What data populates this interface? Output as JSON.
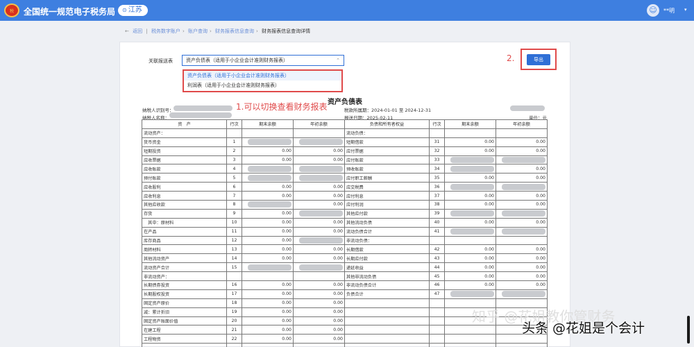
{
  "header": {
    "logo_text": "税",
    "title": "全国统一规范电子税务局",
    "region": "江苏",
    "user_name": "**明",
    "accent_color": "#3e7fe0"
  },
  "breadcrumb": {
    "back": "返回",
    "items": [
      "税务数字账户",
      "账户查询",
      "财务报表信息查询",
      "财务报表信息查询详情"
    ]
  },
  "form": {
    "label": "关联报送表",
    "selected": "资产负债表（适用于小企业会计准则财务报表）",
    "options": [
      "资产负债表（适用于小企业会计准则财务报表）",
      "利润表（适用于小企业会计准则财务报表）"
    ],
    "export_button": "导出"
  },
  "annotations": {
    "switch_note": "1.可以切换查看财务报表",
    "export_note": "2."
  },
  "report": {
    "title": "资产负债表",
    "taxpayer_id_label": "纳税人识别号：",
    "taxpayer_name_label": "纳税人名称：",
    "period": "税款所属期：2024-01-01 至 2024-12-31",
    "filed": "报送日期：2025-02-11",
    "unit": "单位：元",
    "headers": [
      "资　产",
      "行次",
      "期末余额",
      "年初余额",
      "负债和所有者权益",
      "行次",
      "期末余额",
      "年初余额"
    ],
    "rows": [
      [
        "流动资产：",
        "",
        "",
        "",
        "流动负债：",
        "",
        "",
        ""
      ],
      [
        "货币资金",
        "1",
        "#",
        "#",
        "短期借款",
        "31",
        "0.00",
        "0.00"
      ],
      [
        "短期投资",
        "2",
        "0.00",
        "0.00",
        "应付票据",
        "32",
        "0.00",
        "0.00"
      ],
      [
        "应收票据",
        "3",
        "0.00",
        "0.00",
        "应付账款",
        "33",
        "#",
        "#"
      ],
      [
        "应收账款",
        "4",
        "#",
        "#",
        "预收账款",
        "34",
        "#",
        "0.00"
      ],
      [
        "预付账款",
        "5",
        "#",
        "#",
        "应付职工薪酬",
        "35",
        "0.00",
        "0.00"
      ],
      [
        "应收股利",
        "6",
        "0.00",
        "0.00",
        "应交税费",
        "36",
        "#",
        "#"
      ],
      [
        "应收利息",
        "7",
        "0.00",
        "0.00",
        "应付利息",
        "37",
        "0.00",
        "0.00"
      ],
      [
        "其他应收款",
        "8",
        "#",
        "0.00",
        "应付利润",
        "38",
        "0.00",
        "0.00"
      ],
      [
        "存货",
        "9",
        "0.00",
        "#",
        "其他应付款",
        "39",
        "#",
        "#"
      ],
      [
        "　其中：原材料",
        "10",
        "0.00",
        "0.00",
        "其他流动负债",
        "40",
        "0.00",
        "0.00"
      ],
      [
        "在产品",
        "11",
        "0.00",
        "0.00",
        "流动负债合计",
        "41",
        "#",
        "#"
      ],
      [
        "库存商品",
        "12",
        "0.00",
        "#",
        "非流动负债：",
        "",
        "",
        ""
      ],
      [
        "周转材料",
        "13",
        "0.00",
        "0.00",
        "长期借款",
        "42",
        "0.00",
        "0.00"
      ],
      [
        "其他流动资产",
        "14",
        "0.00",
        "0.00",
        "长期应付款",
        "43",
        "0.00",
        "0.00"
      ],
      [
        "流动资产合计",
        "15",
        "#",
        "#",
        "递延收益",
        "44",
        "0.00",
        "0.00"
      ],
      [
        "非流动资产：",
        "",
        "",
        "",
        "其他非流动负债",
        "45",
        "0.00",
        "0.00"
      ],
      [
        "长期债券投资",
        "16",
        "0.00",
        "0.00",
        "非流动负债合计",
        "46",
        "0.00",
        "0.00"
      ],
      [
        "长期股权投资",
        "17",
        "0.00",
        "0.00",
        "负债合计",
        "47",
        "#",
        "#"
      ],
      [
        "固定资产原价",
        "18",
        "0.00",
        "0.00",
        "",
        "",
        "",
        ""
      ],
      [
        "减：累计折旧",
        "19",
        "0.00",
        "0.00",
        "",
        "",
        "",
        ""
      ],
      [
        "固定资产账面价值",
        "20",
        "0.00",
        "0.00",
        "",
        "",
        "",
        ""
      ],
      [
        "在建工程",
        "21",
        "0.00",
        "0.00",
        "",
        "",
        "",
        ""
      ],
      [
        "工程物资",
        "22",
        "0.00",
        "0.00",
        "",
        "",
        "",
        ""
      ],
      [
        "",
        "",
        "",
        "",
        "",
        "",
        "",
        ""
      ]
    ]
  },
  "watermark": {
    "zhihu": "知乎 @花姐教你管财务",
    "toutiao": "头条 @花姐是个会计"
  }
}
